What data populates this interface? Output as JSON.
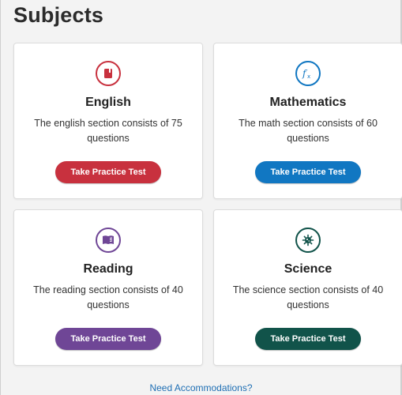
{
  "page": {
    "title": "Subjects"
  },
  "subjects": [
    {
      "id": "english",
      "title": "English",
      "description": "The english section consists of 75 questions",
      "button_label": "Take Practice Test",
      "color": "#c8313e",
      "icon": "book-icon"
    },
    {
      "id": "math",
      "title": "Mathematics",
      "description": "The math section consists of 60 questions",
      "button_label": "Take Practice Test",
      "color": "#1177c2",
      "icon": "function-icon",
      "icon_text": "fx"
    },
    {
      "id": "reading",
      "title": "Reading",
      "description": "The reading section consists of 40 questions",
      "button_label": "Take Practice Test",
      "color": "#6f4696",
      "icon": "open-book-icon"
    },
    {
      "id": "science",
      "title": "Science",
      "description": "The science section consists of 40 questions",
      "button_label": "Take Practice Test",
      "color": "#11534a",
      "icon": "virus-icon"
    }
  ],
  "footer": {
    "link_label": "Need Accommodations?",
    "link_color": "#1f6fb4"
  }
}
